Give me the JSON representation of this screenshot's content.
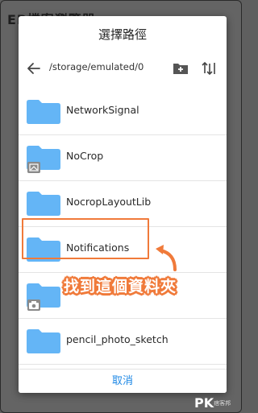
{
  "background": {
    "title": "EP檔案瀏覽器"
  },
  "dialog": {
    "title": "選擇路徑",
    "path": "/storage/emulated/0",
    "icons": {
      "back": "arrow-left-icon",
      "new_folder": "create-new-folder-icon",
      "sort": "sort-icon"
    },
    "folders": [
      {
        "name": "NetworkSignal",
        "badge": ""
      },
      {
        "name": "NoCrop",
        "badge": "image-icon"
      },
      {
        "name": "NocropLayoutLib",
        "badge": ""
      },
      {
        "name": "Notifications",
        "badge": ""
      },
      {
        "name": "",
        "badge": "camera-icon"
      },
      {
        "name": "pencil_photo_sketch",
        "badge": ""
      }
    ],
    "cancel_label": "取消"
  },
  "annotation": {
    "text": "找到這個資料夾",
    "color": "#f07a3a"
  },
  "watermark": {
    "brand": "PK",
    "sub": "痞客邦"
  },
  "colors": {
    "folder": "#64b5f6",
    "accent": "#1e88e5",
    "highlight": "#f07a3a"
  }
}
